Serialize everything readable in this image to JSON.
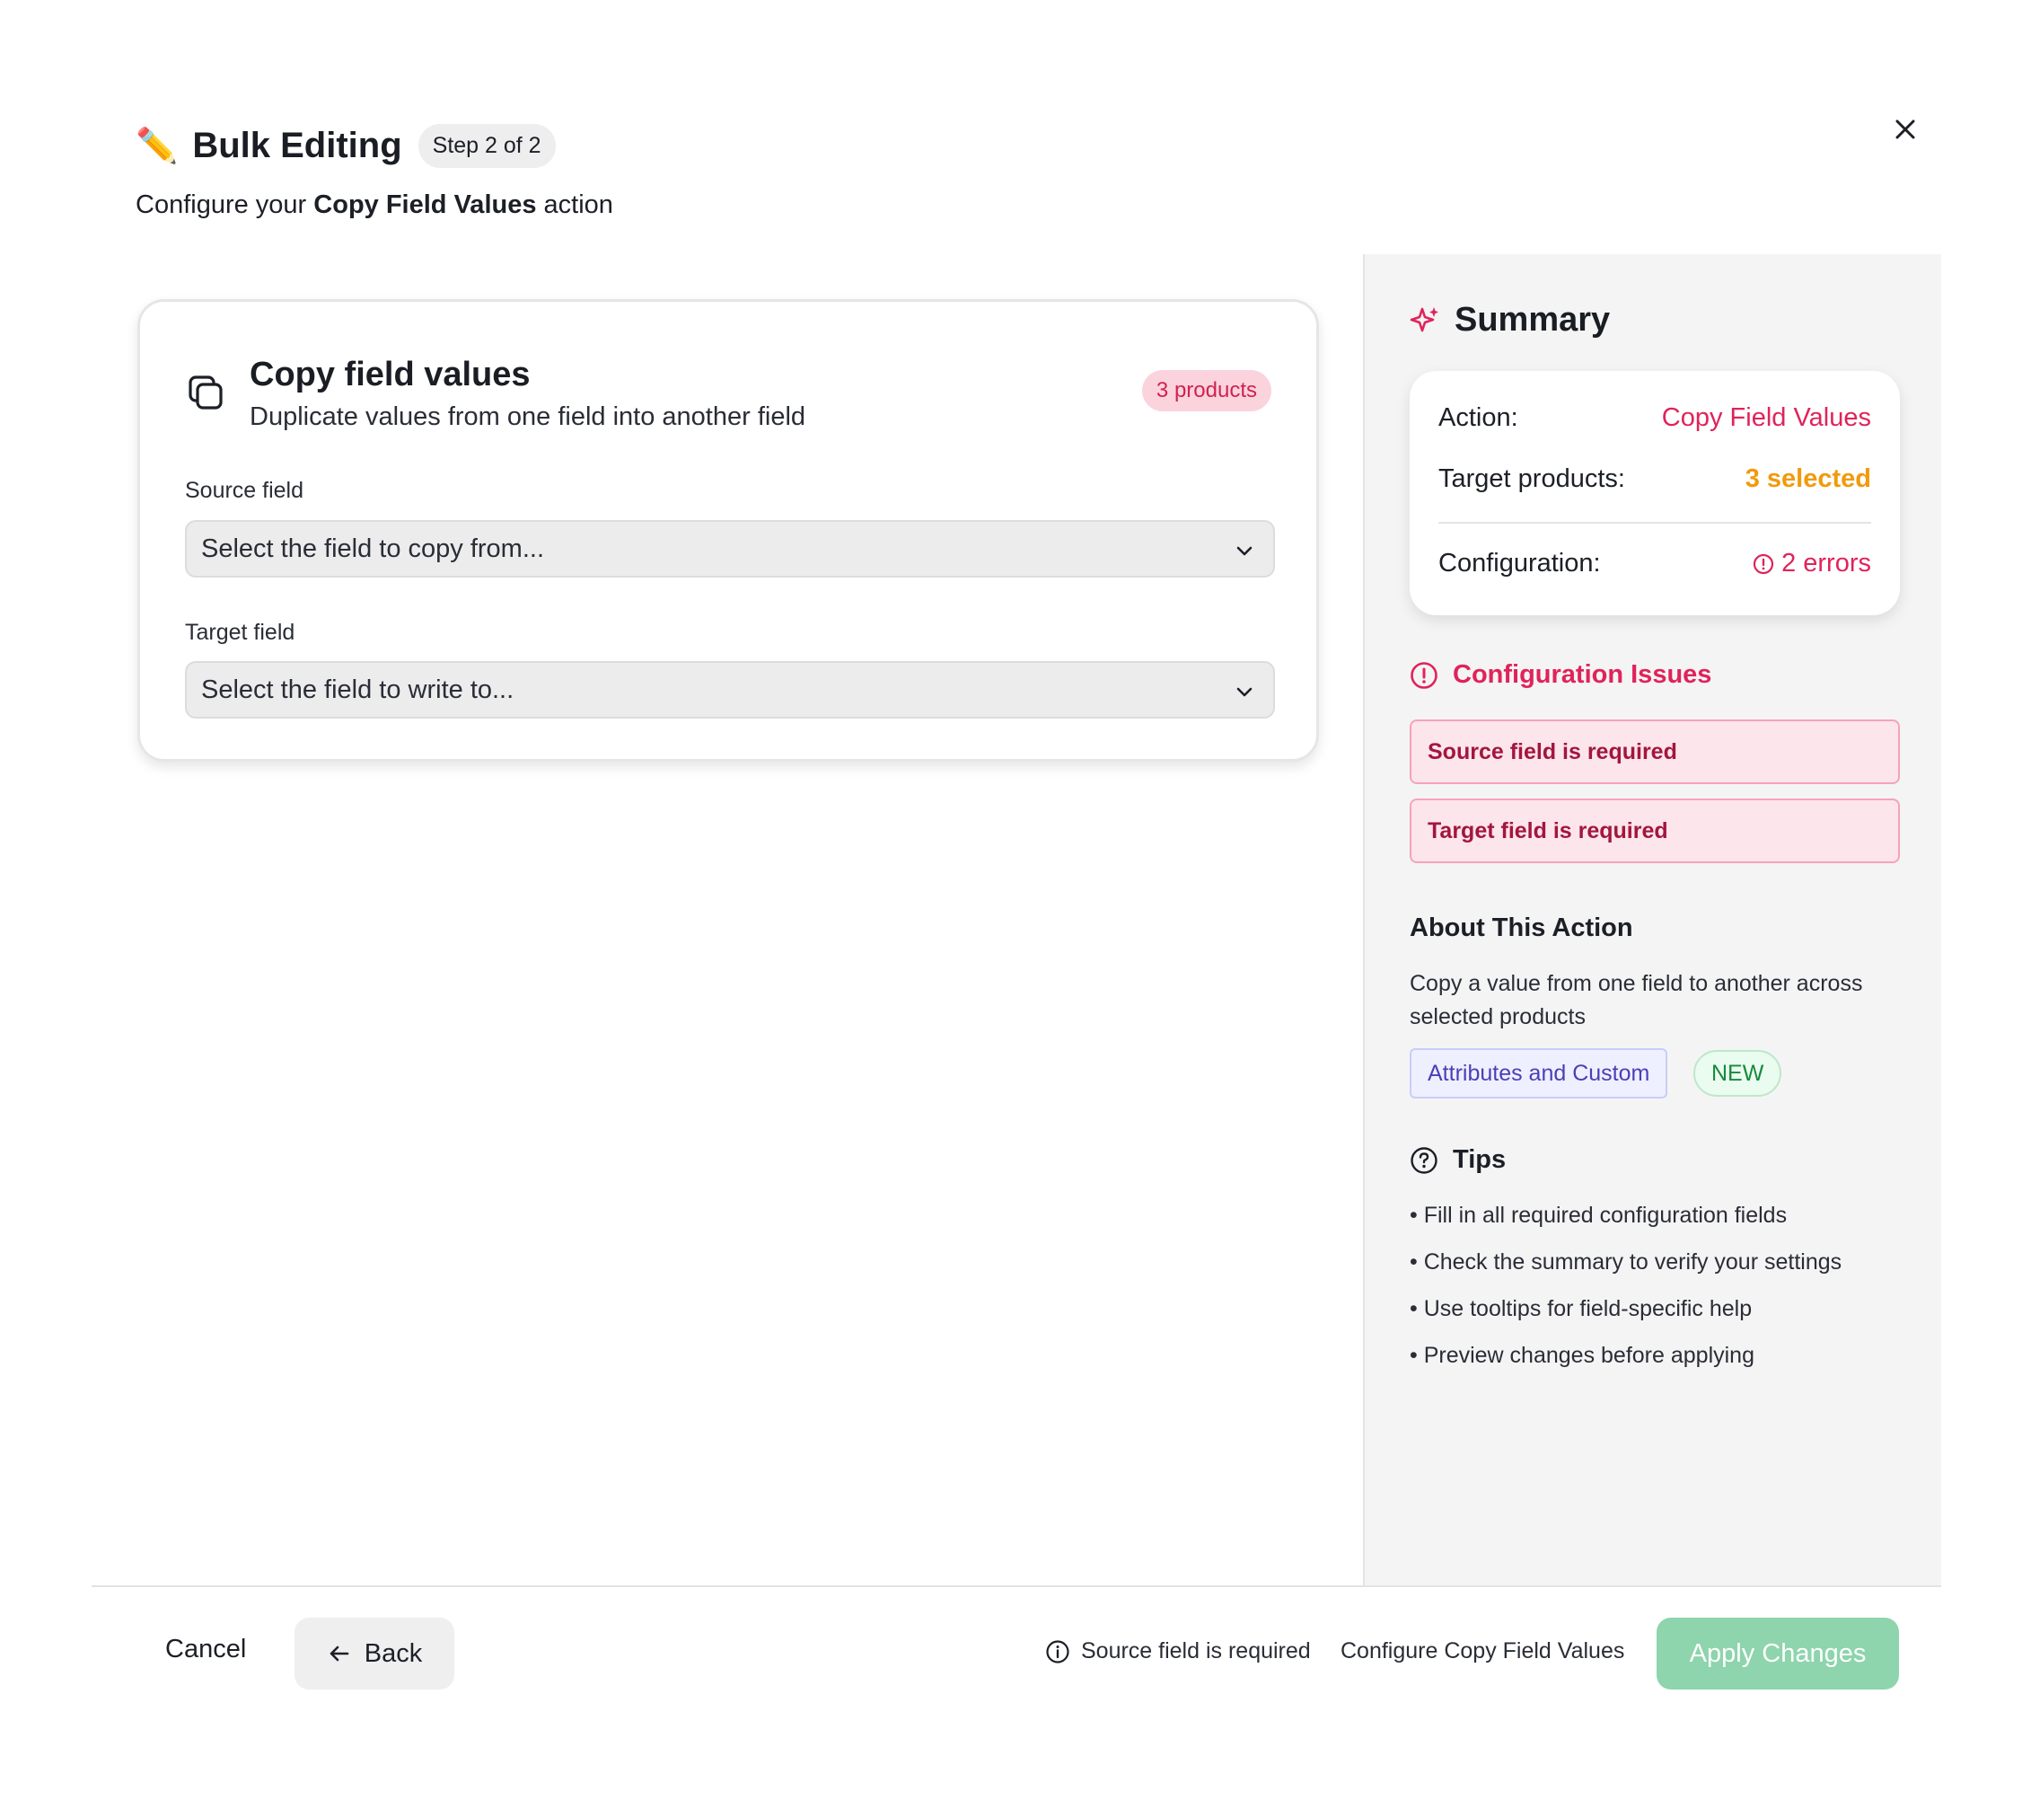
{
  "header": {
    "icon": "pencil-icon",
    "title": "Bulk Editing",
    "step": "Step 2 of 2",
    "subtitle_prefix": "Configure your ",
    "subtitle_action": "Copy Field Values",
    "subtitle_suffix": " action",
    "close_icon": "close-icon"
  },
  "card": {
    "icon": "copy-icon",
    "title": "Copy field values",
    "description": "Duplicate values from one field into another field",
    "products_badge": "3 products",
    "source_label": "Source field",
    "source_placeholder": "Select the field to copy from...",
    "target_label": "Target field",
    "target_placeholder": "Select the field to write to..."
  },
  "summary": {
    "icon": "sparkles-icon",
    "title": "Summary",
    "action_label": "Action:",
    "action_value": "Copy Field Values",
    "target_label": "Target products:",
    "target_value": "3 selected",
    "config_label": "Configuration:",
    "config_value": "2 errors"
  },
  "issues": {
    "title": "Configuration Issues",
    "items": [
      "Source field is required",
      "Target field is required"
    ]
  },
  "about": {
    "title": "About This Action",
    "text": "Copy a value from one field to another across selected products",
    "tag": "Attributes and Custom",
    "badge": "NEW"
  },
  "tips": {
    "title": "Tips",
    "items": [
      "• Fill in all required configuration fields",
      "• Check the summary to verify your settings",
      "• Use tooltips for field-specific help",
      "• Preview changes before applying"
    ]
  },
  "footer": {
    "cancel": "Cancel",
    "back": "Back",
    "status": "Source field is required",
    "config": "Configure Copy Field Values",
    "apply": "Apply Changes"
  },
  "colors": {
    "accent": "#e0235a",
    "warning": "#f19a0c",
    "apply_disabled": "#8ed4ad"
  }
}
